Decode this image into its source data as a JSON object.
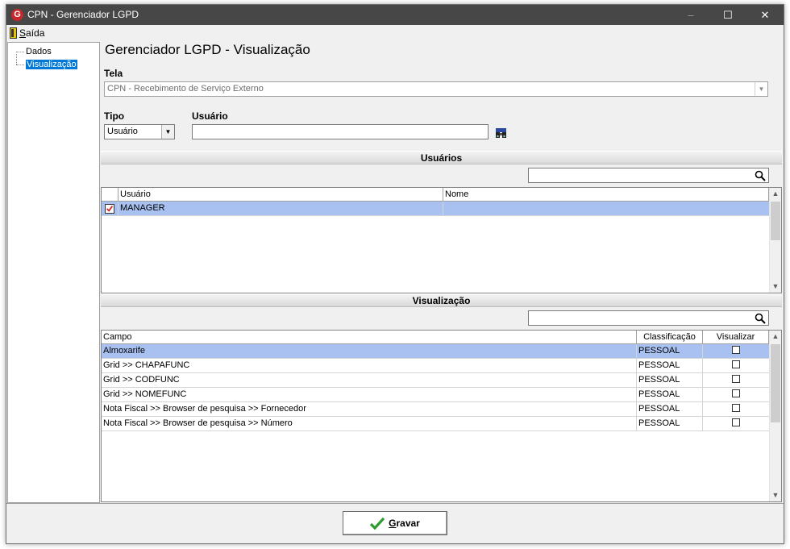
{
  "window": {
    "title": "CPN - Gerenciador LGPD",
    "app_icon_letter": "G",
    "minimize": "–",
    "maximize": "☐",
    "close": "✕"
  },
  "menu": {
    "exit_label_first": "S",
    "exit_label_rest": "aída"
  },
  "tree": {
    "items": [
      {
        "label": "Dados"
      },
      {
        "label": "Visualização"
      }
    ]
  },
  "heading": "Gerenciador LGPD - Visualização",
  "tela": {
    "label": "Tela",
    "value": "CPN - Recebimento de Serviço Externo"
  },
  "tipo": {
    "label": "Tipo",
    "value": "Usuário"
  },
  "usuario_field": {
    "label": "Usuário",
    "value": ""
  },
  "users_section": {
    "title": "Usuários",
    "search_value": "",
    "columns": [
      "Usuário",
      "Nome"
    ],
    "rows": [
      {
        "checked": true,
        "usuario": "MANAGER",
        "nome": ""
      }
    ]
  },
  "view_section": {
    "title": "Visualização",
    "search_value": "",
    "columns": [
      "Campo",
      "Classificação",
      "Visualizar"
    ],
    "rows": [
      {
        "campo": "Almoxarife",
        "classificacao": "PESSOAL",
        "visualizar": false
      },
      {
        "campo": "Grid >> CHAPAFUNC",
        "classificacao": "PESSOAL",
        "visualizar": false
      },
      {
        "campo": "Grid >> CODFUNC",
        "classificacao": "PESSOAL",
        "visualizar": false
      },
      {
        "campo": "Grid >> NOMEFUNC",
        "classificacao": "PESSOAL",
        "visualizar": false
      },
      {
        "campo": "Nota Fiscal >> Browser de pesquisa >> Fornecedor",
        "classificacao": "PESSOAL",
        "visualizar": false
      },
      {
        "campo": "Nota Fiscal >> Browser de pesquisa >> Número",
        "classificacao": "PESSOAL",
        "visualizar": false
      }
    ]
  },
  "save_button": {
    "label_first": "G",
    "label_rest": "ravar"
  },
  "colors": {
    "titlebar": "#474747",
    "selection": "#a8c1f0",
    "tree_selection": "#0078d7",
    "check_green": "#2e9b2e",
    "check_red": "#d11a1a"
  }
}
